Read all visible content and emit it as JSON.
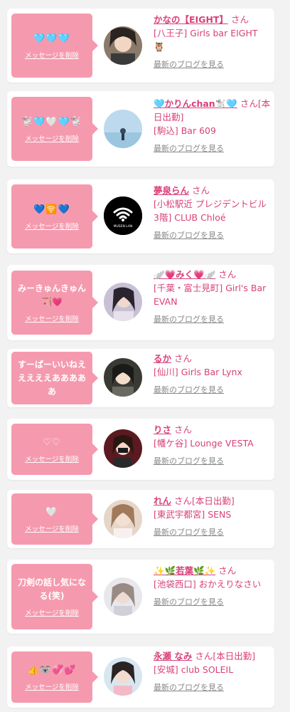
{
  "messages": [
    {
      "message": "🩵🩵🩵",
      "delete_label": "メッセージを削除",
      "name": "かなの【EIGHT】",
      "san": "さん",
      "shop": "[八王子] Girls bar EIGHT 🦉",
      "blog_label": "最新のブログを見る"
    },
    {
      "message": "🐩🩵🤍🩵🐩",
      "delete_label": "メッセージを削除",
      "name": "🩵かりんchan🐩🩵",
      "san": "さん[本日出勤]",
      "shop": "[駒込] Bar 609",
      "blog_label": "最新のブログを見る"
    },
    {
      "message": "💙🛜💙",
      "delete_label": "メッセージを削除",
      "name": "夢泉らん",
      "san": "さん",
      "shop": "[小松駅近 プレジデントビル3階] CLUB Chloé",
      "blog_label": "最新のブログを見る"
    },
    {
      "message": "みーきゅんきゅん🏹💗",
      "delete_label": "メッセージを削除",
      "name": "🪽💗みく💗🪽",
      "san": "さん",
      "shop": "[千葉・富士見町] Girl's Bar EVAN",
      "blog_label": "最新のブログを見る"
    },
    {
      "message": "すーぱーいいねえええええあああああ",
      "delete_label": "メッセージを削除",
      "name": "るか",
      "san": "さん",
      "shop": "[仙川] Girls Bar Lynx",
      "blog_label": "最新のブログを見る"
    },
    {
      "message": "♡♡",
      "delete_label": "メッセージを削除",
      "name": "りさ",
      "san": "さん",
      "shop": "[幡ケ谷] Lounge VESTA",
      "blog_label": "最新のブログを見る"
    },
    {
      "message": "🤍",
      "delete_label": "メッセージを削除",
      "name": "れん",
      "san": "さん[本日出勤]",
      "shop": "[東武宇都宮] SENS",
      "blog_label": "最新のブログを見る"
    },
    {
      "message": "刀剣の話し気になる(笑)",
      "delete_label": "メッセージを削除",
      "name": "✨🌿若葉🌿✨",
      "san": "さん",
      "shop": "[池袋西口] おかえりなさい",
      "blog_label": "最新のブログを見る"
    },
    {
      "message": "👍🐨💞💕",
      "delete_label": "メッセージを削除",
      "name": "永瀬 なみ",
      "san": "さん[本日出勤]",
      "shop": "[安城] club SOLEIL",
      "blog_label": "最新のブログを見る"
    }
  ],
  "colors": {
    "bubble": "#f59aae",
    "accent": "#d9407a",
    "muted": "#888888",
    "background": "#f2f2f2"
  },
  "icons": {
    "wifi_avatar": "wifi-icon",
    "wifi_caption": "MUSEN LAN"
  }
}
